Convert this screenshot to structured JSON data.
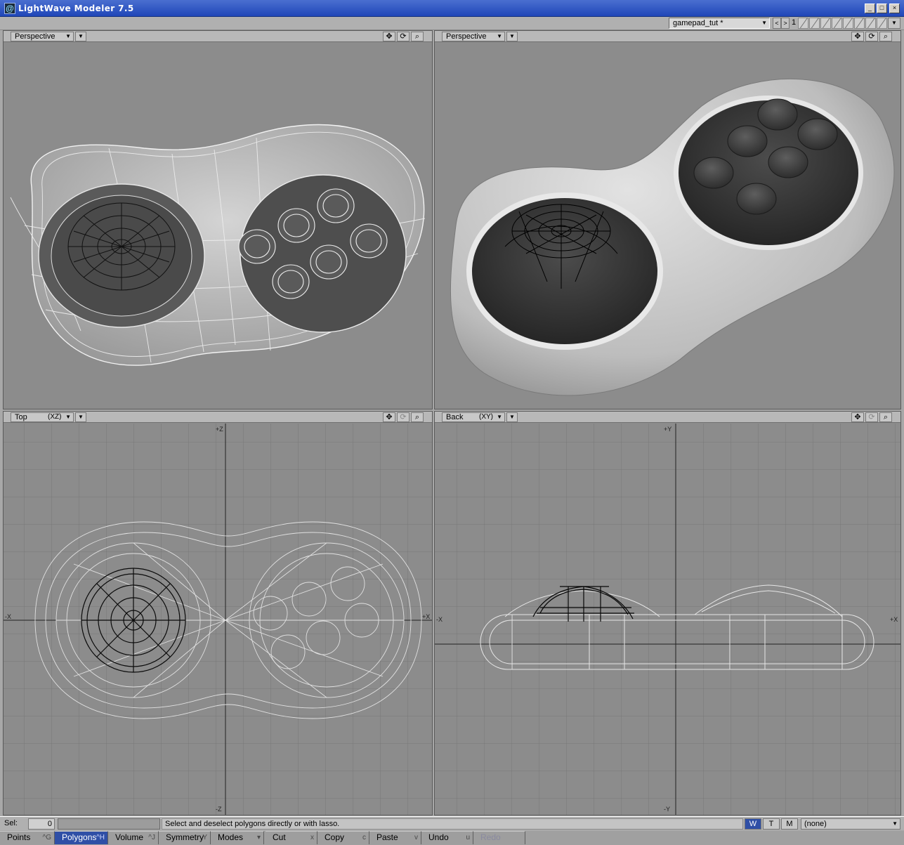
{
  "window": {
    "title": "LightWave Modeler 7.5",
    "minimize": "_",
    "maximize": "□",
    "close": "×"
  },
  "topbar": {
    "object": "gamepad_tut *",
    "prev": "<",
    "next": ">",
    "layer": "1"
  },
  "viewports": [
    {
      "view": "Perspective",
      "axis": "",
      "mode": "Wireframe Shade"
    },
    {
      "view": "Perspective",
      "axis": "",
      "mode": "Smooth Shade"
    },
    {
      "view": "Top",
      "axis": "(XZ)",
      "mode": "Wireframe",
      "labels": {
        "top": "+Z",
        "bottom": "-Z",
        "left": "-X",
        "right": "+X"
      }
    },
    {
      "view": "Back",
      "axis": "(XY)",
      "mode": "Wireframe",
      "labels": {
        "top": "+Y",
        "bottom": "-Y",
        "left": "-X",
        "right": "+X"
      }
    }
  ],
  "viewport_tools": {
    "move": "✥",
    "rotate": "⟳",
    "zoom": "⌕"
  },
  "status": {
    "sel_label": "Sel:",
    "sel_count": "0",
    "help": "Select and deselect polygons directly or with lasso.",
    "w": "W",
    "t": "T",
    "m": "M",
    "surface": "(none)"
  },
  "bottombar": [
    {
      "label": "Points",
      "key": "^G"
    },
    {
      "label": "Polygons",
      "key": "^H"
    },
    {
      "label": "Volume",
      "key": "^J"
    },
    {
      "label": "Symmetry",
      "key": "Y"
    },
    {
      "label": "Modes",
      "key": "▾"
    },
    {
      "label": "Cut",
      "key": "x"
    },
    {
      "label": "Copy",
      "key": "c"
    },
    {
      "label": "Paste",
      "key": "v"
    },
    {
      "label": "Undo",
      "key": "u"
    },
    {
      "label": "Redo",
      "key": ""
    }
  ],
  "colors": {
    "titlebar": "#1f46b8",
    "viewport_bg": "#8c8c8c",
    "active_button": "#2f4fa6"
  }
}
